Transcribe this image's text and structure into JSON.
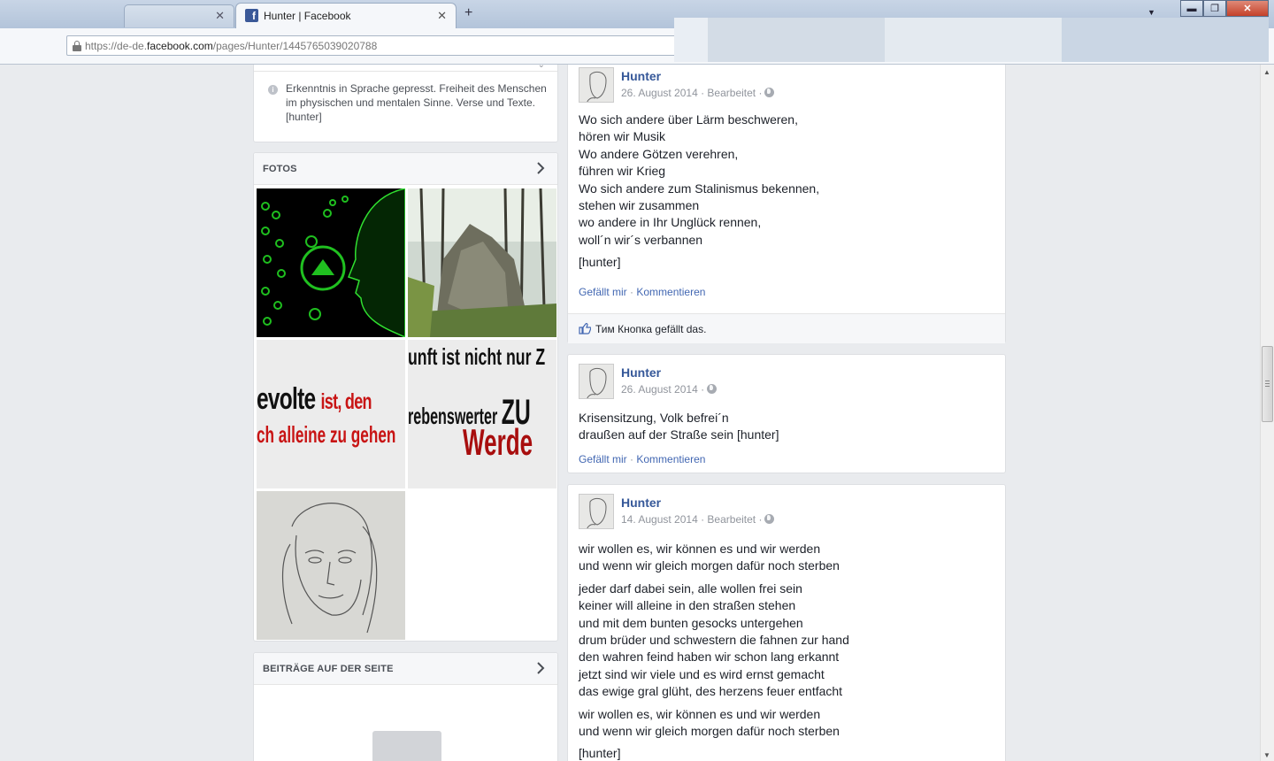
{
  "browser": {
    "inactive_tab_close": "✕",
    "active_tab_title": "Hunter | Facebook",
    "active_tab_close": "✕",
    "new_tab": "+",
    "url_prefix": "https://de-de.",
    "url_domain": "facebook.com",
    "url_path": "/pages/Hunter/1445765039020788",
    "tab_list_arrow": "▼",
    "window_minimize": "▬",
    "window_maximize": "❐",
    "window_close": "✕"
  },
  "sidebar": {
    "about_text": "Erkenntnis in Sprache gepresst. Freiheit des Menschen im physischen und mentalen Sinne. Verse und Texte. [hunter]",
    "photos_header": "FOTOS",
    "photos": [
      {
        "desc": "green-face-icon-photo"
      },
      {
        "desc": "rock-forest-photo"
      },
      {
        "desc": "revolte-text-photo",
        "lines": [
          "evolte",
          "ist, den",
          "ch alleine zu gehen"
        ]
      },
      {
        "desc": "vernunft-text-photo",
        "lines": [
          "unft ist nicht nur Z",
          "rebenswerter",
          "ZU",
          "Werde"
        ]
      },
      {
        "desc": "pencil-portrait-photo"
      }
    ],
    "posts_header": "BEITRÄGE AUF DER SEITE"
  },
  "posts": [
    {
      "author": "Hunter",
      "date": "26. August 2014",
      "edited": "· Bearbeitet ·",
      "paragraphs": [
        [
          "Wo sich andere über Lärm beschweren,",
          "hören wir Musik",
          "Wo andere Götzen verehren,",
          "führen wir Krieg",
          "Wo sich andere zum Stalinismus bekennen,",
          "stehen wir zusammen",
          "wo andere in Ihr Unglück rennen,",
          "woll´n wir´s verbannen"
        ],
        [
          "[hunter]"
        ]
      ],
      "like_label": "Gefällt mir",
      "comment_label": "Kommentieren",
      "likes_text": "Тим Кнопка gefällt das."
    },
    {
      "author": "Hunter",
      "date": "26. August 2014",
      "edited": "·",
      "paragraphs": [
        [
          "Krisensitzung, Volk befrei´n",
          "draußen auf der Straße sein [hunter]"
        ]
      ],
      "like_label": "Gefällt mir",
      "comment_label": "Kommentieren"
    },
    {
      "author": "Hunter",
      "date": "14. August 2014",
      "edited": "· Bearbeitet ·",
      "paragraphs": [
        [
          "wir wollen es, wir können es und wir werden",
          "und wenn wir gleich morgen dafür noch sterben"
        ],
        [
          "jeder darf dabei sein, alle wollen frei sein",
          "keiner will alleine in den straßen stehen",
          "und mit dem bunten gesocks untergehen",
          "drum brüder und schwestern die fahnen zur hand",
          "den wahren feind haben wir schon lang erkannt",
          "jetzt sind wir viele und es wird ernst gemacht",
          "das ewige gral glüht, des herzens feuer entfacht"
        ],
        [
          "wir wollen es, wir können es und wir werden",
          "und wenn wir gleich morgen dafür noch sterben"
        ],
        [
          "[hunter]"
        ]
      ]
    }
  ]
}
